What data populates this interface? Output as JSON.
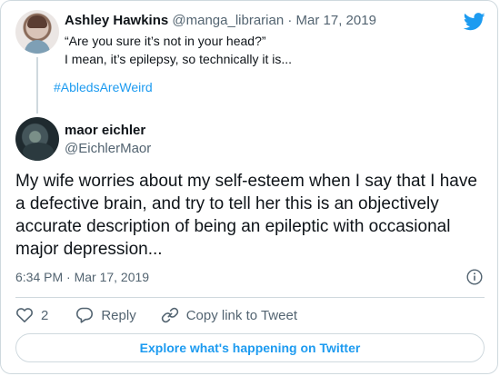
{
  "parent_tweet": {
    "author_name": "Ashley Hawkins",
    "author_handle": "@manga_librarian",
    "separator": "·",
    "date": "Mar 17, 2019",
    "text_line1": "“Are you sure it’s not in your head?”",
    "text_line2": "I mean, it’s epilepsy, so technically it is...",
    "hashtag": "#AbledsAreWeird"
  },
  "main_tweet": {
    "author_name": "maor eichler",
    "author_handle": "@EichlerMaor",
    "text": "My wife worries about my self-esteem when I say that I have a defective brain, and try to tell her this is an objectively accurate description of being an epileptic with occasional major depression...",
    "timestamp": "6:34 PM · Mar 17, 2019"
  },
  "actions": {
    "like_count": "2",
    "reply_label": "Reply",
    "copy_link_label": "Copy link to Tweet"
  },
  "footer": {
    "explore_label": "Explore what's happening on Twitter"
  },
  "icons": {
    "brand": "twitter-bird-icon",
    "info": "info-icon",
    "like": "heart-icon",
    "reply": "reply-bubble-icon",
    "copy_link": "link-icon"
  },
  "colors": {
    "accent": "#1d9bf0",
    "text": "#0f1419",
    "muted": "#536471",
    "border": "#cfd9de"
  }
}
